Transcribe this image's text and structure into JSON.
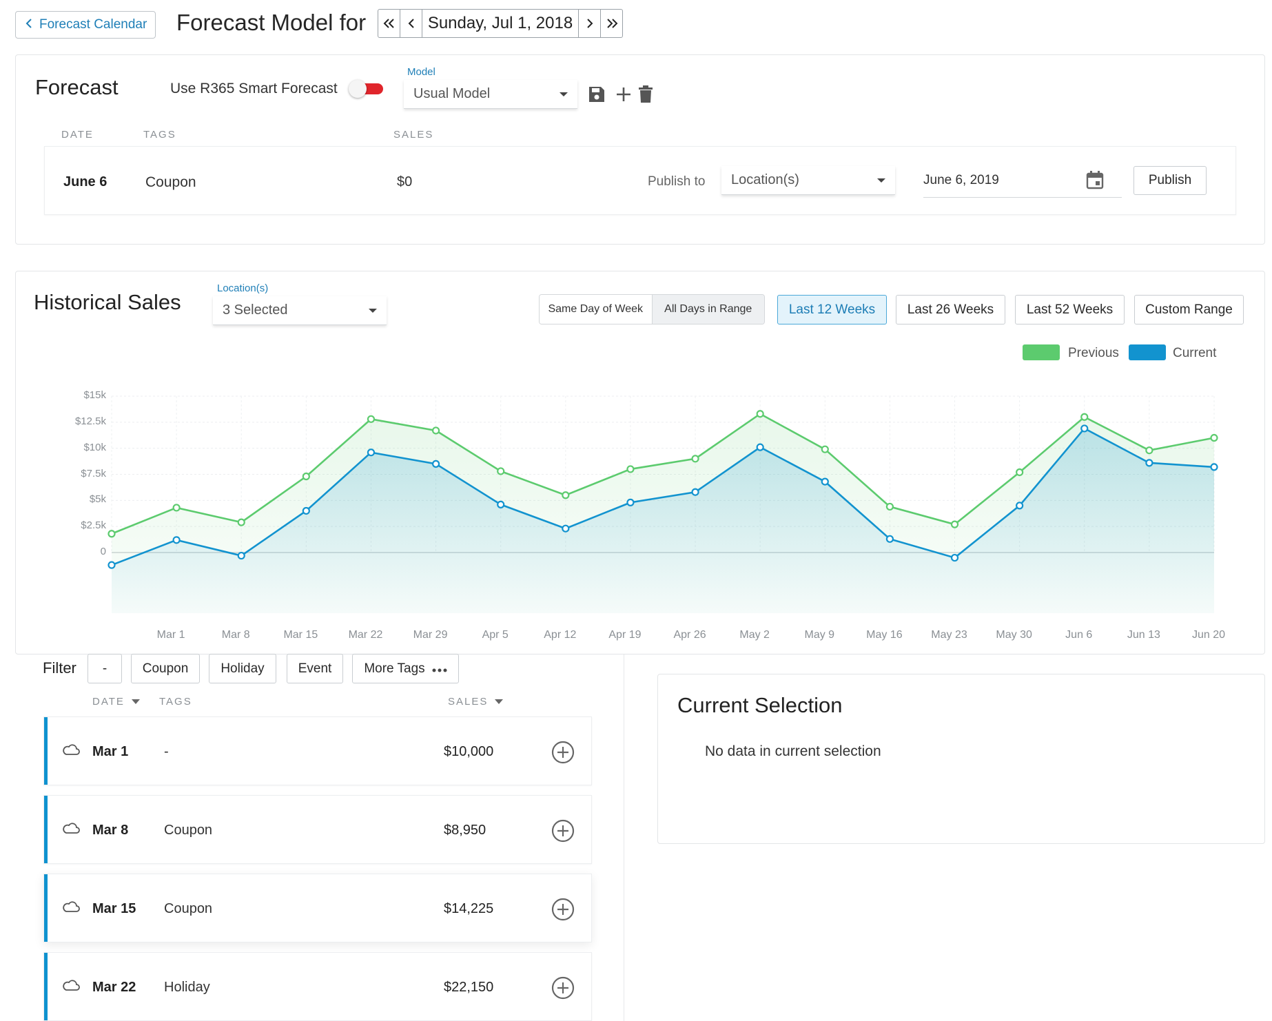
{
  "topbar": {
    "back_label": "Forecast Calendar",
    "title": "Forecast Model for",
    "date": "Sunday, Jul 1, 2018"
  },
  "forecast": {
    "title": "Forecast",
    "smart_label": "Use R365 Smart Forecast",
    "smart_enabled": true,
    "model_label": "Model",
    "model_value": "Usual Model",
    "columns": [
      "DATE",
      "TAGS",
      "SALES"
    ],
    "row": {
      "date": "June 6",
      "tag": "Coupon",
      "sales": "$0"
    },
    "publish_to_label": "Publish to",
    "location_placeholder": "Location(s)",
    "publish_date": "June 6, 2019",
    "publish_button": "Publish"
  },
  "historical": {
    "title": "Historical Sales",
    "location_label": "Location(s)",
    "location_value": "3 Selected",
    "toggle": [
      "Same Day of Week",
      "All Days in Range"
    ],
    "ranges": [
      "Last 12 Weeks",
      "Last 26 Weeks",
      "Last 52 Weeks",
      "Custom Range"
    ],
    "active_range": "Last 12 Weeks",
    "legend": {
      "previous": "Previous",
      "current": "Current"
    },
    "colors": {
      "previous": "#5ccb6e",
      "current": "#1293cf"
    }
  },
  "chart_data": {
    "type": "line",
    "y_ticks": [
      "$15k",
      "$12.5k",
      "$10k",
      "$7.5k",
      "$5k",
      "$2.5k",
      "0"
    ],
    "ylim": [
      0,
      15000
    ],
    "x": [
      "Mar 1",
      "Mar 8",
      "Mar 15",
      "Mar 22",
      "Mar 29",
      "Apr 5",
      "Apr 12",
      "Apr 19",
      "Apr 26",
      "May 2",
      "May 9",
      "May 16",
      "May 23",
      "May 30",
      "Jun 6",
      "Jun 13",
      "Jun 20"
    ],
    "grid": true,
    "legend_position": "top-right",
    "series": [
      {
        "name": "Previous",
        "color": "#5ccb6e",
        "values": [
          1800,
          4300,
          2900,
          7300,
          12800,
          11700,
          7800,
          5500,
          8000,
          9000,
          13300,
          9900,
          4400,
          2700,
          7700,
          13000,
          9800,
          11000
        ]
      },
      {
        "name": "Current",
        "color": "#1293cf",
        "values": [
          -1200,
          1200,
          -300,
          4000,
          9600,
          8500,
          4600,
          2300,
          4800,
          5800,
          10100,
          6800,
          1300,
          -500,
          4500,
          11900,
          8600,
          8200
        ]
      }
    ]
  },
  "filter": {
    "label": "Filter",
    "tags": [
      "-",
      "Coupon",
      "Holiday",
      "Event",
      "More Tags"
    ],
    "columns": {
      "date": "DATE",
      "tags": "TAGS",
      "sales": "SALES"
    }
  },
  "rows": [
    {
      "date": "Mar 1",
      "tag": "-",
      "sales": "$10,000"
    },
    {
      "date": "Mar 8",
      "tag": "Coupon",
      "sales": "$8,950"
    },
    {
      "date": "Mar 15",
      "tag": "Coupon",
      "sales": "$14,225"
    },
    {
      "date": "Mar 22",
      "tag": "Holiday",
      "sales": "$22,150"
    }
  ],
  "selection": {
    "title": "Current Selection",
    "empty": "No data in current selection"
  }
}
